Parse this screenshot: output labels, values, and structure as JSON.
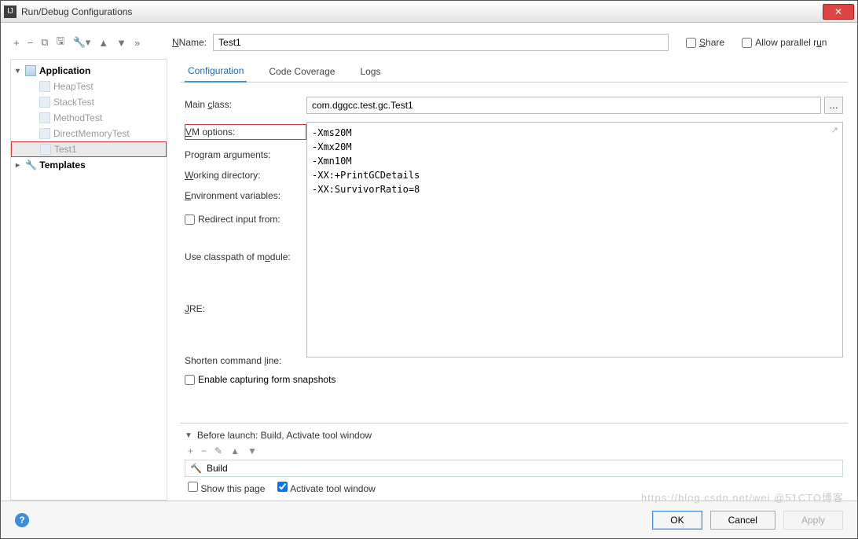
{
  "window": {
    "title": "Run/Debug Configurations"
  },
  "topbar": {
    "icons": {
      "add": "+",
      "remove": "−",
      "copy": "⧉",
      "save": "🖫",
      "wrench": "🔧",
      "up": "▲",
      "down": "▼",
      "expand": "»"
    },
    "name_label": "Name:",
    "name_value": "Test1",
    "share_label": "Share",
    "allow_parallel_label": "Allow parallel run"
  },
  "tree": {
    "application": {
      "label": "Application",
      "expanded": true,
      "children": [
        {
          "label": "HeapTest"
        },
        {
          "label": "StackTest"
        },
        {
          "label": "MethodTest"
        },
        {
          "label": "DirectMemoryTest"
        },
        {
          "label": "Test1",
          "selected": true,
          "highlight": true
        }
      ]
    },
    "templates": {
      "label": "Templates"
    }
  },
  "tabs": [
    {
      "label": "Configuration",
      "active": true
    },
    {
      "label": "Code Coverage"
    },
    {
      "label": "Logs"
    }
  ],
  "form": {
    "main_class_label": "Main class:",
    "main_class_value": "com.dggcc.test.gc.Test1",
    "vm_options_label": "VM options:",
    "vm_options_value": "-Xms20M\n-Xmx20M\n-Xmn10M\n-XX:+PrintGCDetails\n-XX:SurvivorRatio=8",
    "program_args_label": "Program arguments:",
    "working_dir_label": "Working directory:",
    "env_vars_label": "Environment variables:",
    "redirect_label": "Redirect input from:",
    "classpath_label": "Use classpath of module:",
    "jre_label": "JRE:",
    "shorten_label": "Shorten command line:",
    "capture_label": "Enable capturing form snapshots"
  },
  "before_launch": {
    "header": "Before launch: Build, Activate tool window",
    "toolbar": {
      "add": "+",
      "remove": "−",
      "edit": "✎",
      "up": "▲",
      "down": "▼"
    },
    "item": "Build",
    "show_page_label": "Show this page",
    "activate_label": "Activate tool window",
    "activate_checked": true
  },
  "footer": {
    "ok": "OK",
    "cancel": "Cancel",
    "apply": "Apply"
  },
  "watermark": "https://blog.csdn.net/wei @51CTO博客"
}
